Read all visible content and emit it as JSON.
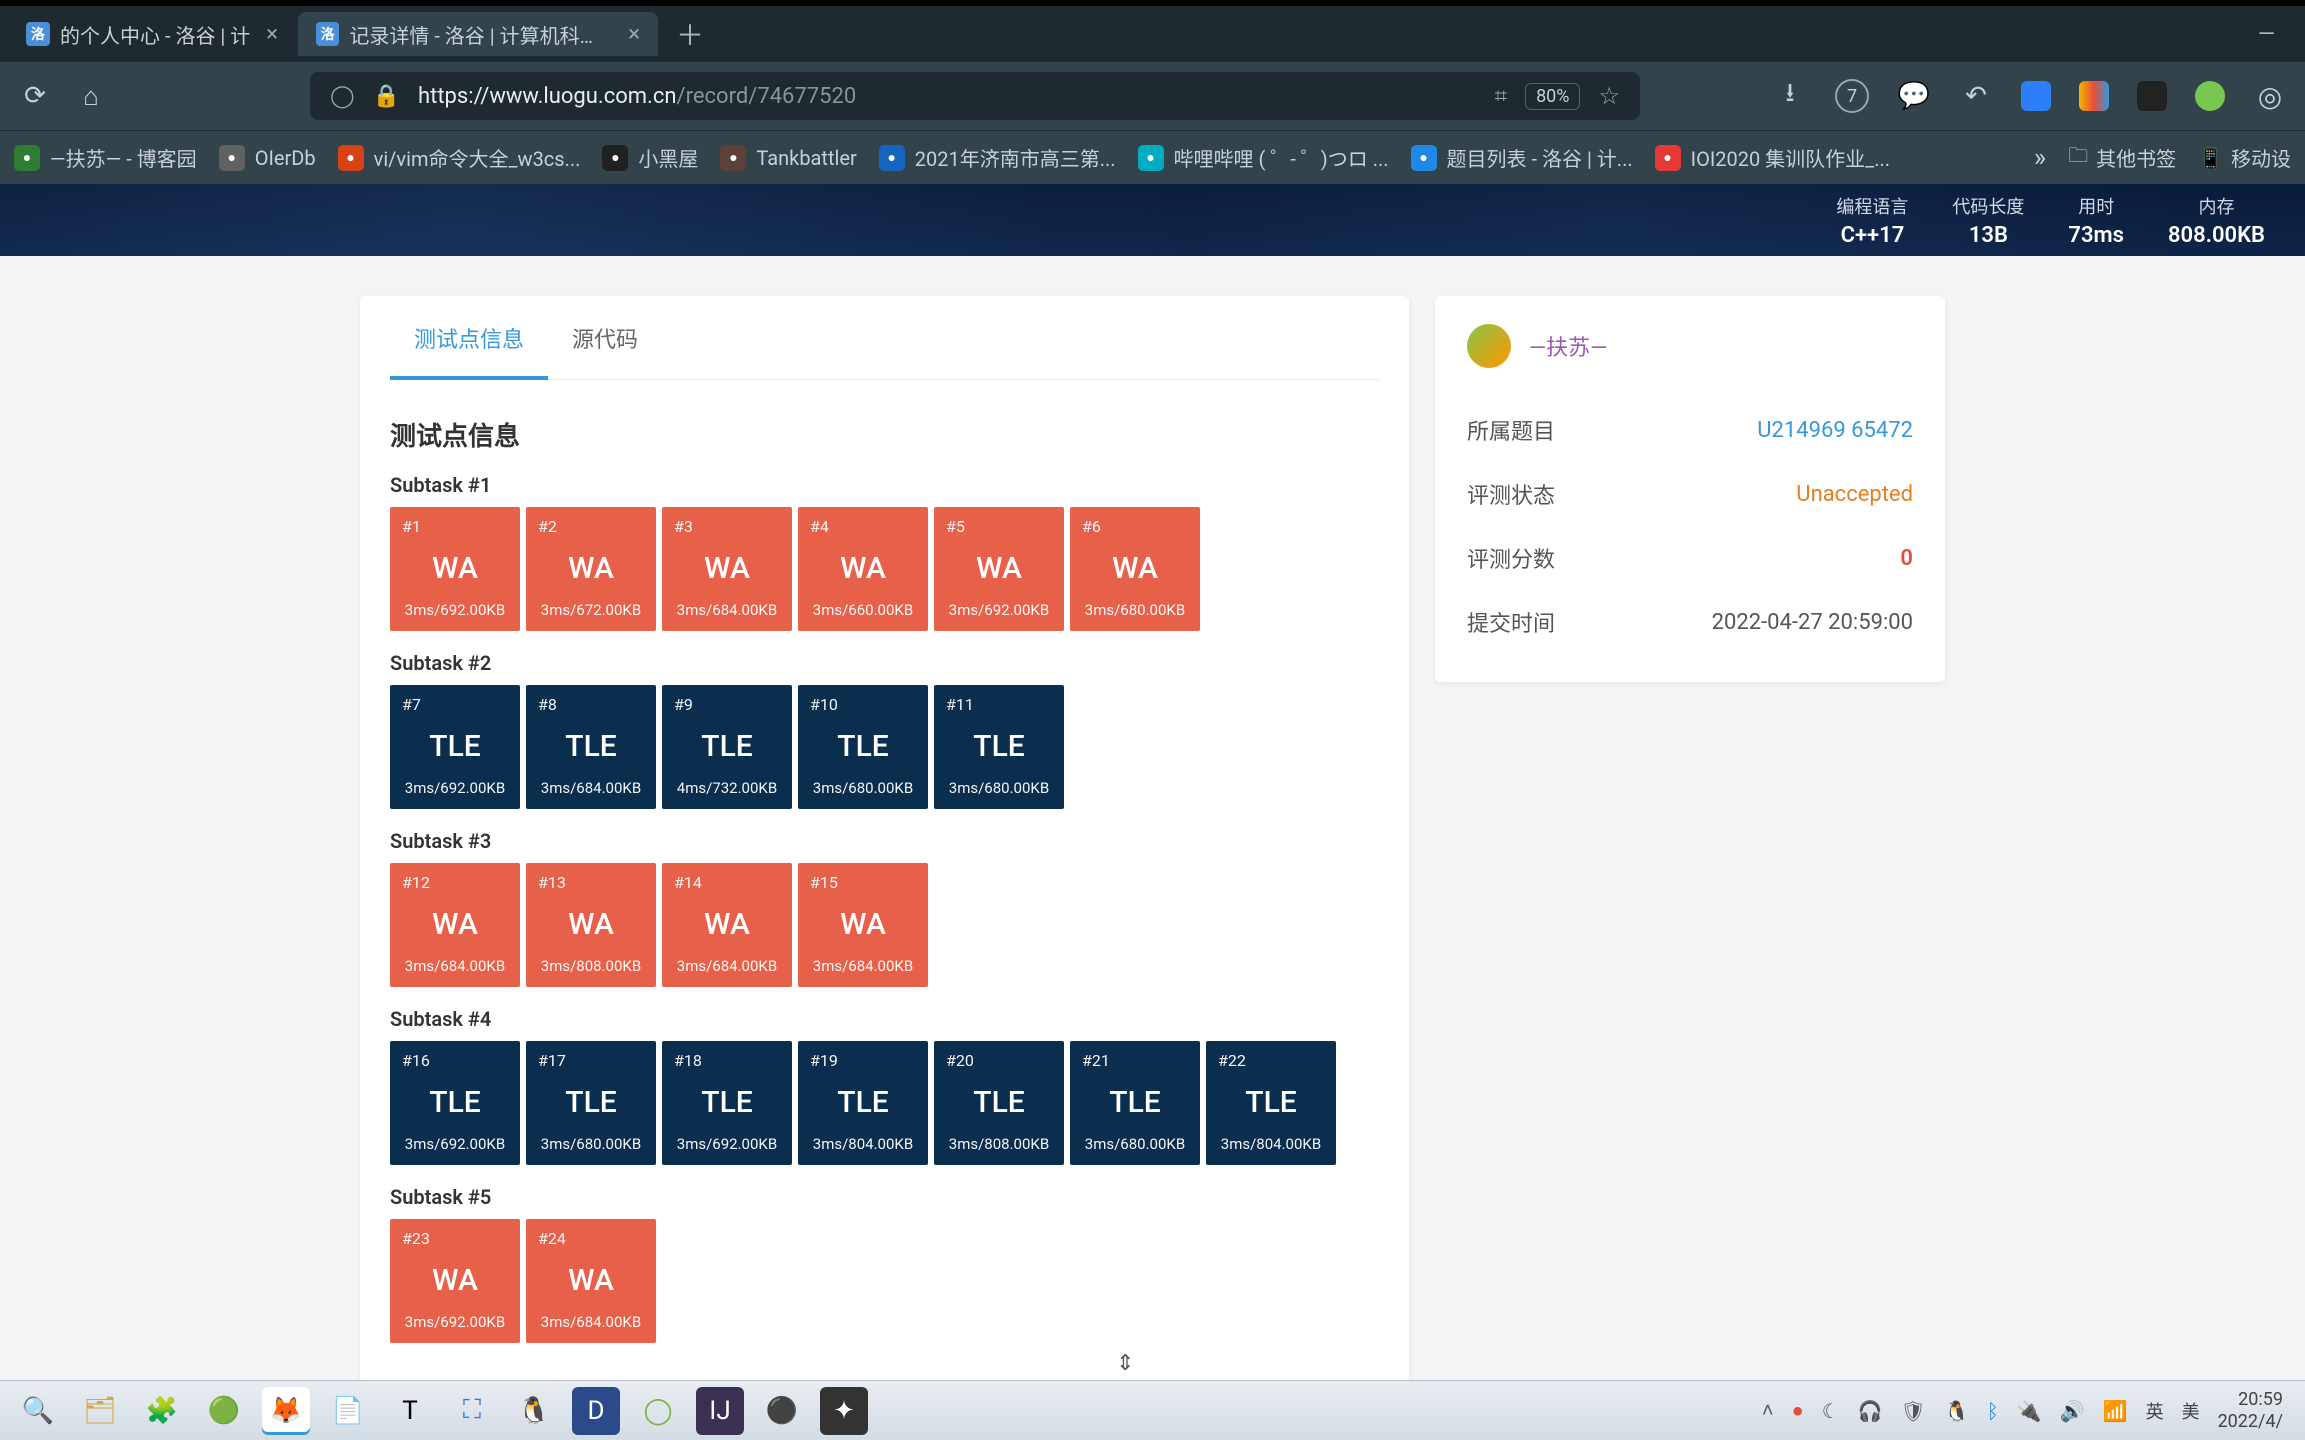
{
  "browser": {
    "tabs": [
      {
        "title": "的个人中心 - 洛谷 | 计",
        "active": false
      },
      {
        "title": "记录详情 - 洛谷 | 计算机科学教",
        "active": true
      }
    ],
    "url_domain": "https://www.luogu.com.cn",
    "url_path": "/record/74677520",
    "zoom": "80%",
    "badge_count": "7",
    "bookmarks": [
      {
        "label": "—扶苏— - 博客园",
        "color": "#2e7d32"
      },
      {
        "label": "OIerDb",
        "color": "#616161"
      },
      {
        "label": "vi/vim命令大全_w3cs...",
        "color": "#d84315"
      },
      {
        "label": "小黑屋",
        "color": "#212121"
      },
      {
        "label": "Tankbattler",
        "color": "#5d4037"
      },
      {
        "label": "2021年济南市高三第...",
        "color": "#1565c0"
      },
      {
        "label": "哔哩哔哩 ( ゜- ゜)つロ ...",
        "color": "#00acc1"
      },
      {
        "label": "题目列表 - 洛谷 | 计...",
        "color": "#1e88e5"
      },
      {
        "label": "IOI2020 集训队作业_...",
        "color": "#e53935"
      }
    ],
    "bm_folder1": "其他书签",
    "bm_folder2": "移动设"
  },
  "header_stats": {
    "lang_label": "编程语言",
    "lang_value": "C++17",
    "len_label": "代码长度",
    "len_value": "13B",
    "time_label": "用时",
    "time_value": "73ms",
    "mem_label": "内存",
    "mem_value": "808.00KB"
  },
  "page_tabs": {
    "active": "测试点信息",
    "inactive": "源代码"
  },
  "section_title": "测试点信息",
  "subtasks": [
    {
      "title": "Subtask #1",
      "cases": [
        {
          "n": "#1",
          "s": "WA",
          "m": "3ms/692.00KB"
        },
        {
          "n": "#2",
          "s": "WA",
          "m": "3ms/672.00KB"
        },
        {
          "n": "#3",
          "s": "WA",
          "m": "3ms/684.00KB"
        },
        {
          "n": "#4",
          "s": "WA",
          "m": "3ms/660.00KB"
        },
        {
          "n": "#5",
          "s": "WA",
          "m": "3ms/692.00KB"
        },
        {
          "n": "#6",
          "s": "WA",
          "m": "3ms/680.00KB"
        }
      ]
    },
    {
      "title": "Subtask #2",
      "cases": [
        {
          "n": "#7",
          "s": "TLE",
          "m": "3ms/692.00KB"
        },
        {
          "n": "#8",
          "s": "TLE",
          "m": "3ms/684.00KB"
        },
        {
          "n": "#9",
          "s": "TLE",
          "m": "4ms/732.00KB"
        },
        {
          "n": "#10",
          "s": "TLE",
          "m": "3ms/680.00KB"
        },
        {
          "n": "#11",
          "s": "TLE",
          "m": "3ms/680.00KB"
        }
      ]
    },
    {
      "title": "Subtask #3",
      "cases": [
        {
          "n": "#12",
          "s": "WA",
          "m": "3ms/684.00KB"
        },
        {
          "n": "#13",
          "s": "WA",
          "m": "3ms/808.00KB"
        },
        {
          "n": "#14",
          "s": "WA",
          "m": "3ms/684.00KB"
        },
        {
          "n": "#15",
          "s": "WA",
          "m": "3ms/684.00KB"
        }
      ]
    },
    {
      "title": "Subtask #4",
      "cases": [
        {
          "n": "#16",
          "s": "TLE",
          "m": "3ms/692.00KB"
        },
        {
          "n": "#17",
          "s": "TLE",
          "m": "3ms/680.00KB"
        },
        {
          "n": "#18",
          "s": "TLE",
          "m": "3ms/692.00KB"
        },
        {
          "n": "#19",
          "s": "TLE",
          "m": "3ms/804.00KB"
        },
        {
          "n": "#20",
          "s": "TLE",
          "m": "3ms/808.00KB"
        },
        {
          "n": "#21",
          "s": "TLE",
          "m": "3ms/680.00KB"
        },
        {
          "n": "#22",
          "s": "TLE",
          "m": "3ms/804.00KB"
        }
      ]
    },
    {
      "title": "Subtask #5",
      "cases": [
        {
          "n": "#23",
          "s": "WA",
          "m": "3ms/692.00KB"
        },
        {
          "n": "#24",
          "s": "WA",
          "m": "3ms/684.00KB"
        }
      ]
    }
  ],
  "side": {
    "username": "—扶苏—",
    "problem_label": "所属题目",
    "problem_value": "U214969 65472",
    "status_label": "评测状态",
    "status_value": "Unaccepted",
    "score_label": "评测分数",
    "score_value": "0",
    "time_label": "提交时间",
    "time_value": "2022-04-27 20:59:00"
  },
  "taskbar": {
    "clock_time": "20:59",
    "clock_date": "2022/4/",
    "ime_lang": "英",
    "ime_sub": "美"
  }
}
